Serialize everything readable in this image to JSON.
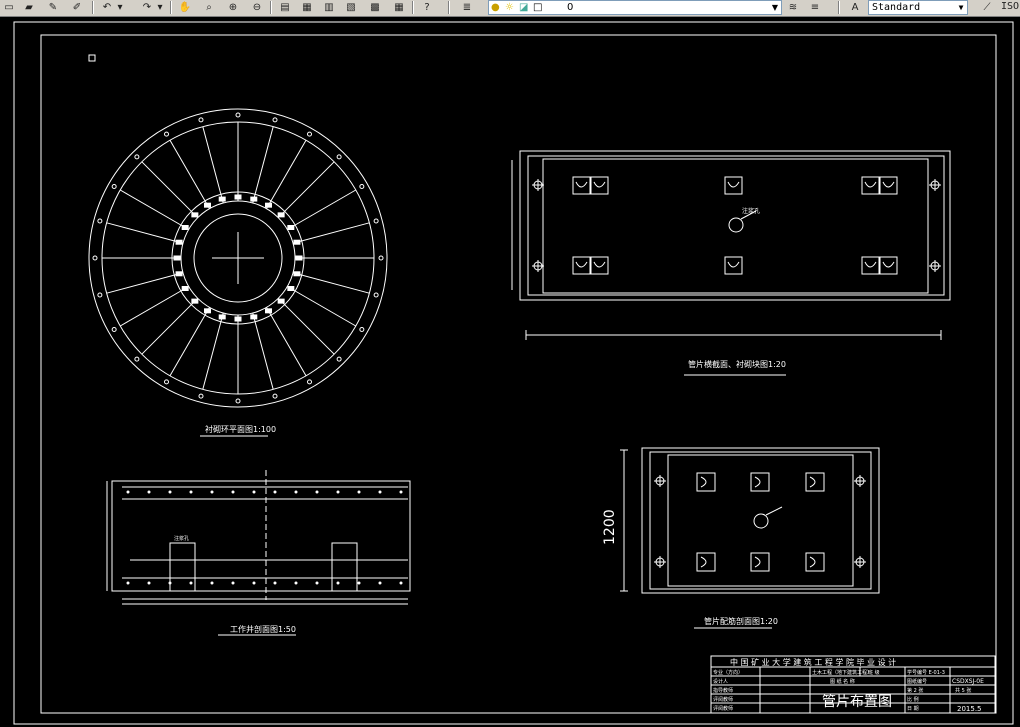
{
  "toolbar": {
    "layer_value": "0",
    "text_style_value": "Standard",
    "dim_style_value": "ISO"
  },
  "drawing": {
    "view_ring_caption": "衬砌环平面图1:100",
    "view_segment_caption": "管片横截面、衬砌块图1:20",
    "view_section_caption": "工作井剖面图1:50",
    "view_plan_caption": "管片配筋剖面图1:20",
    "dimension_1200": "1200",
    "grout_label": "注浆孔",
    "grout_label_2": "注浆孔"
  },
  "title_block": {
    "institution": "中 国 矿 业 大 学 建 筑 工 程 学 院 毕 业 设 计",
    "row1_col1": "专业（方向）",
    "row1_col2": "土木工程（地下建筑工程）",
    "row1_col3": "班 级",
    "row1_col4": "学号编号 E-01-3",
    "row2_col1": "设计人",
    "row2_col2": "图 纸 名 称",
    "row2_col3": "图纸编号",
    "row2_col4": "CSDXSJ-0E",
    "row3_col1": "指导教师",
    "row3_col3": "第 2 张",
    "row3_col4": "共 5 张",
    "row4_col1": "评阅教师",
    "row4_col3": "比 例",
    "row5_col1": "评阅教师",
    "row5_col3": "日 期",
    "row5_col4": "2015.5",
    "drawing_title": "管片布置图"
  }
}
